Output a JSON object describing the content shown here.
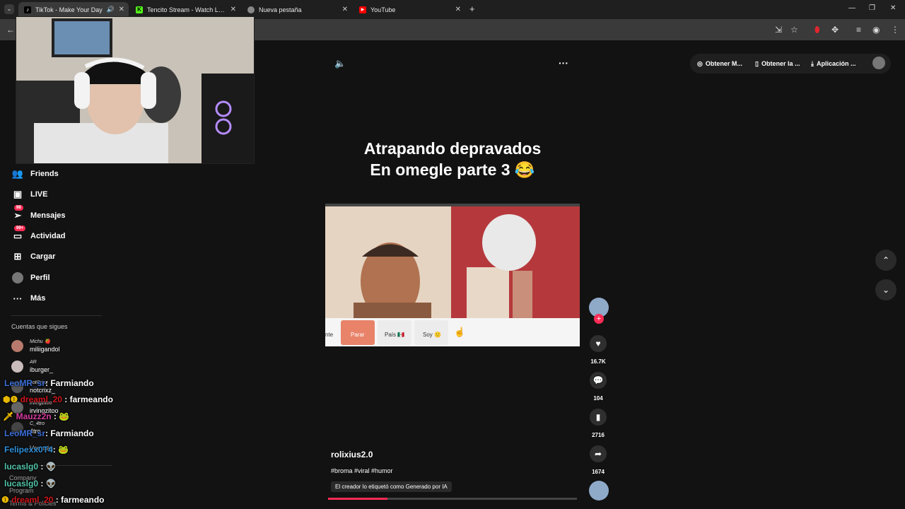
{
  "browser": {
    "tabs": [
      {
        "title": "TikTok - Make Your Day"
      },
      {
        "title": "Tencito Stream - Watch Live on"
      },
      {
        "title": "Nueva pestaña"
      },
      {
        "title": "YouTube"
      }
    ]
  },
  "tiktok": {
    "sidebar": [
      {
        "label": "Friends",
        "icon": "friends-icon"
      },
      {
        "label": "LIVE",
        "icon": "live-icon"
      },
      {
        "label": "Mensajes",
        "icon": "messages-icon",
        "badge": "98"
      },
      {
        "label": "Actividad",
        "icon": "activity-icon",
        "badge": "99+"
      },
      {
        "label": "Cargar",
        "icon": "upload-icon"
      },
      {
        "label": "Perfil",
        "icon": "profile-icon"
      },
      {
        "label": "Más",
        "icon": "more-icon"
      }
    ],
    "following_title": "Cuentas que sigues",
    "following": [
      {
        "display": "Michu 🍓",
        "handle": "miliigandol"
      },
      {
        "display": "AR",
        "handle": "iburger_"
      },
      {
        "display": "notCrixz",
        "handle": "notcrixz_"
      },
      {
        "display": "irvingzitoo",
        "handle": "irvingzitoo"
      },
      {
        "display": "C_4tro",
        "handle": "4tro"
      },
      {
        "display": "Ver más",
        "handle": ""
      }
    ],
    "footer": [
      "Company",
      "Program",
      "Terms & Policies"
    ],
    "top_actions": [
      "Obtener M...",
      "Obtener la ...",
      "Aplicación ..."
    ],
    "video": {
      "title_line1": "Atrapando depravados",
      "title_line2": "En omegle parte 3 😂",
      "author": "rolixius2.0",
      "hashtags": "#broma #viral #humor",
      "ai_label": "El creador lo etiquetó como Generado por IA",
      "omegle_buttons": [
        "nte",
        "Parar",
        "País 🇲🇽",
        "Soy 🙂"
      ]
    },
    "stats": {
      "likes": "16.7K",
      "comments": "104",
      "saves": "2716",
      "shares": "1674"
    },
    "progress_fraction": 0.24
  },
  "chat": [
    {
      "user": "LeoMR_sr",
      "msg": ": Farmiando",
      "color": "#3c6fd8"
    },
    {
      "user": "dreaml_20",
      "msg": " : farmeando",
      "color": "#d0161b"
    },
    {
      "user": "Mauzz2n",
      "msg": " : 🐸",
      "color": "#d63aa0"
    },
    {
      "user": "LeoMR_sr",
      "msg": ": Farmiando",
      "color": "#3c6fd8"
    },
    {
      "user": "Felipexx0T4",
      "msg": ": 🐸",
      "color": "#2f8fd8"
    },
    {
      "user": "lucaslg0",
      "msg": " : 👽",
      "color": "#51c3a8"
    },
    {
      "user": "lucaslg0",
      "msg": " : 👽",
      "color": "#51c3a8"
    },
    {
      "user": "dreaml_20",
      "msg": " : farmeando",
      "color": "#d0161b"
    }
  ]
}
